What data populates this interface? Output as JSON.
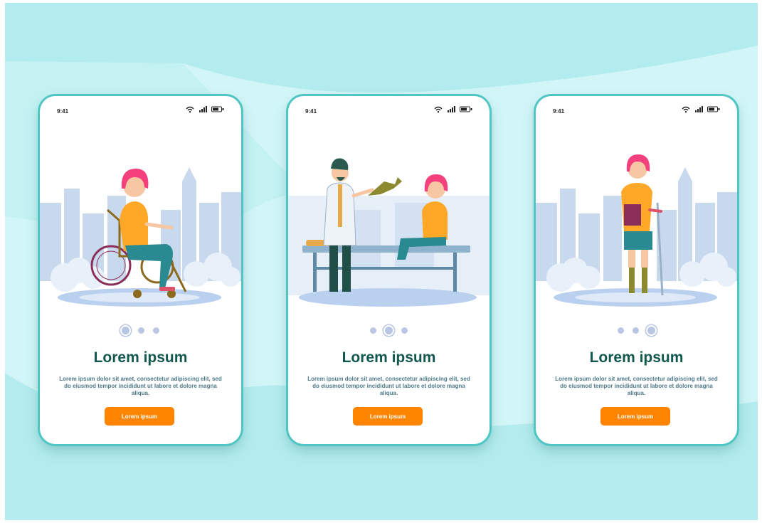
{
  "colors": {
    "background": "#b3ecee",
    "background_band": "#d2f6f7",
    "title": "#12584f",
    "body_text": "#4d7a8a",
    "button": "#ff8500",
    "button_text": "#ffffff",
    "phone_border": "#4fc6c3",
    "dot": "#b9c6e4",
    "skyline": "#c9d9ed"
  },
  "screens": [
    {
      "illustration": "woman-in-wheelchair-illustration",
      "status": {
        "time": "9:41",
        "icons": [
          "wifi-icon",
          "signal-icon",
          "battery-icon"
        ]
      },
      "pager": {
        "count": 3,
        "active_index": 0
      },
      "title": "Lorem ipsum",
      "body": "Lorem ipsum dolor sit amet, consectetur adipiscing elit, sed do eiusmod tempor incididunt ut labore et dolore magna aliqua.",
      "button_label": "Lorem ipsum"
    },
    {
      "illustration": "doctor-with-prosthetic-leg-illustration",
      "status": {
        "time": "9:41",
        "icons": [
          "wifi-icon",
          "signal-icon",
          "battery-icon"
        ]
      },
      "pager": {
        "count": 3,
        "active_index": 1
      },
      "title": "Lorem ipsum",
      "body": "Lorem ipsum dolor sit amet, consectetur adipiscing elit, sed do eiusmod tempor incididunt ut labore et dolore magna aliqua.",
      "button_label": "Lorem ipsum"
    },
    {
      "illustration": "woman-with-prosthetic-legs-and-crutch-illustration",
      "status": {
        "time": "9:41",
        "icons": [
          "wifi-icon",
          "signal-icon",
          "battery-icon"
        ]
      },
      "pager": {
        "count": 3,
        "active_index": 2
      },
      "title": "Lorem ipsum",
      "body": "Lorem ipsum dolor sit amet, consectetur adipiscing elit, sed do eiusmod tempor incididunt ut labore et dolore magna aliqua.",
      "button_label": "Lorem ipsum"
    }
  ]
}
